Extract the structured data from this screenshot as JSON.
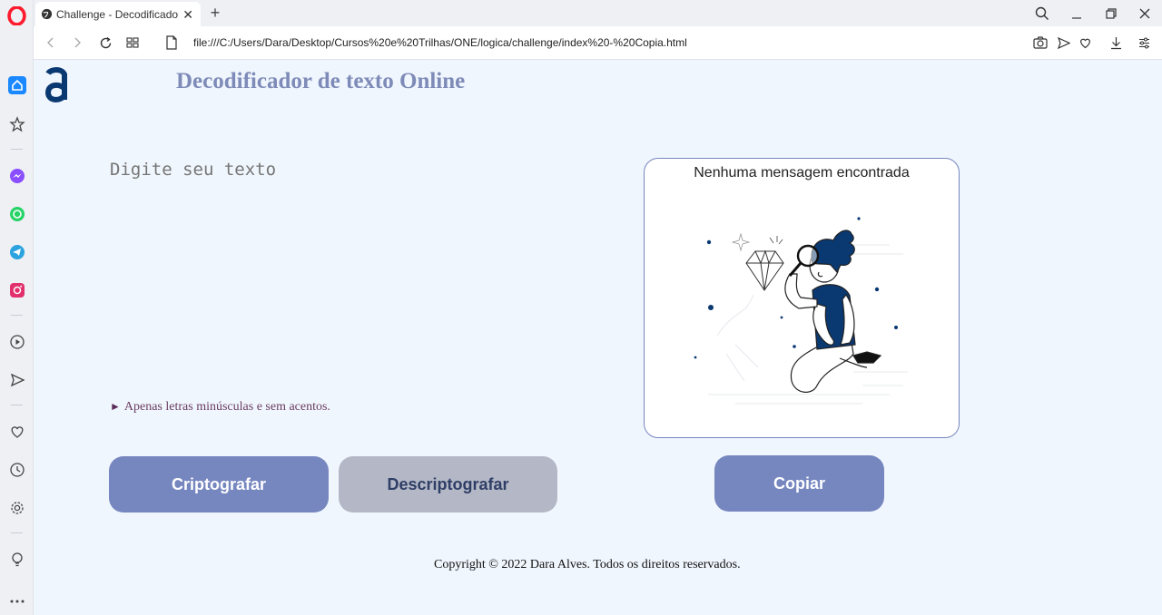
{
  "browser": {
    "tab_title": "Challenge - Decodificador",
    "url": "file:///C:/Users/Dara/Desktop/Cursos%20e%20Trilhas/ONE/logica/challenge/index%20-%20Copia.html",
    "accent": "#ff1b2d"
  },
  "page": {
    "title": "Decodificador de texto Online",
    "input_placeholder": "Digite seu texto",
    "hint_text": "Apenas letras minúsculas e sem acentos.",
    "hint_marker": "►",
    "encrypt_button": "Criptografar",
    "decrypt_button": "Descriptografar",
    "copy_button": "Copiar",
    "message_title": "Nenhuma mensagem encontrada",
    "footer": "Copyright © 2022 Dara Alves. Todos os direitos reservados."
  },
  "colors": {
    "background": "#f0f6fd",
    "primary_button": "#7686bf",
    "secondary_button": "#b4b8c6",
    "title_text": "#7e8bb8",
    "logo": "#0a3871"
  }
}
